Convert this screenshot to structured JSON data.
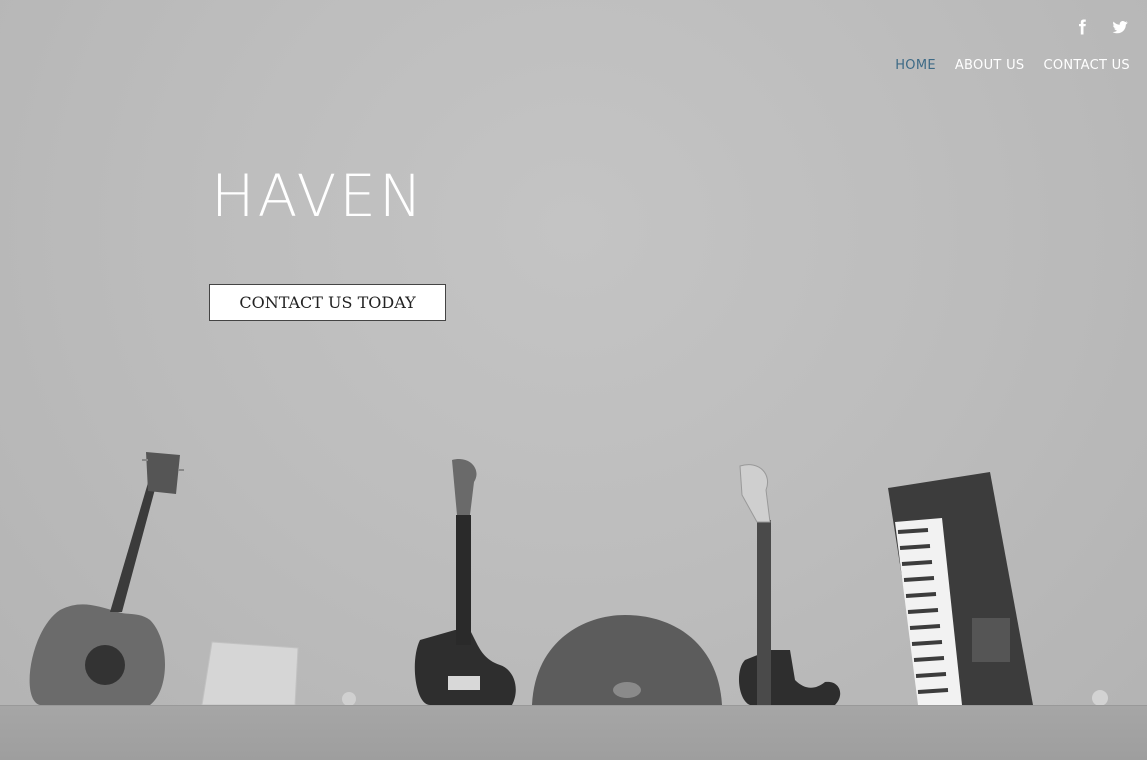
{
  "social": {
    "icons": [
      "facebook-icon",
      "twitter-icon"
    ]
  },
  "nav": {
    "items": [
      {
        "label": "HOME",
        "active": true
      },
      {
        "label": "ABOUT US",
        "active": false
      },
      {
        "label": "CONTACT US",
        "active": false
      }
    ]
  },
  "hero": {
    "title": "HAVEN",
    "cta_label": "CONTACT US TODAY"
  },
  "colors": {
    "nav_active": "#3d6a86",
    "nav_text": "#ffffff",
    "background": "#bdbdbd"
  }
}
